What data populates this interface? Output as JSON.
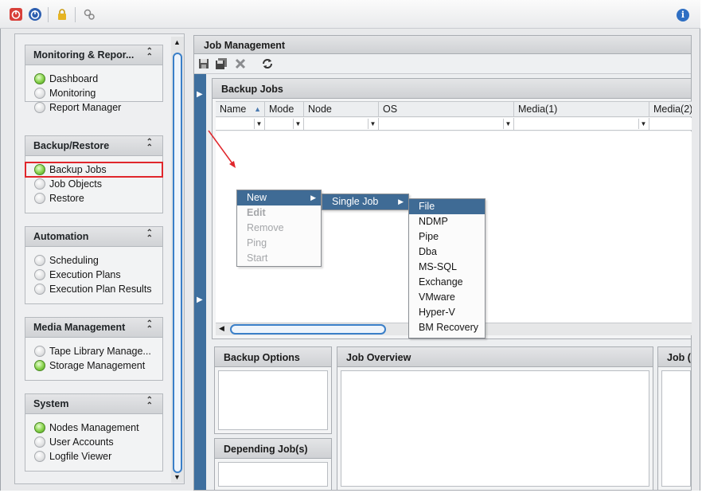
{
  "sidebar": {
    "groups": [
      {
        "title": "Monitoring & Repor...",
        "items": [
          {
            "label": "Dashboard",
            "active": true
          },
          {
            "label": "Monitoring",
            "active": false
          },
          {
            "label": "Report Manager",
            "active": false
          }
        ]
      },
      {
        "title": "Backup/Restore",
        "items": [
          {
            "label": "Backup Jobs",
            "active": true
          },
          {
            "label": "Job Objects",
            "active": false
          },
          {
            "label": "Restore",
            "active": false
          }
        ]
      },
      {
        "title": "Automation",
        "items": [
          {
            "label": "Scheduling",
            "active": false
          },
          {
            "label": "Execution Plans",
            "active": false
          },
          {
            "label": "Execution Plan Results",
            "active": false
          }
        ]
      },
      {
        "title": "Media Management",
        "items": [
          {
            "label": "Tape Library Manage...",
            "active": false
          },
          {
            "label": "Storage Management",
            "active": true
          }
        ]
      },
      {
        "title": "System",
        "items": [
          {
            "label": "Nodes Management",
            "active": true
          },
          {
            "label": "User Accounts",
            "active": false
          },
          {
            "label": "Logfile Viewer",
            "active": false
          }
        ]
      }
    ]
  },
  "main": {
    "title": "Job Management",
    "backup_jobs": {
      "title": "Backup Jobs",
      "columns": [
        "Name",
        "Mode",
        "Node",
        "OS",
        "Media(1)",
        "Media(2)"
      ]
    },
    "panels": {
      "backup_options": "Backup Options",
      "job_overview": "Job Overview",
      "job_third": "Job (",
      "depending_jobs": "Depending Job(s)"
    }
  },
  "context_menu": {
    "items": [
      {
        "label": "New",
        "enabled": true,
        "highlighted": true,
        "submenu": true
      },
      {
        "label": "Edit",
        "enabled": false
      },
      {
        "label": "Remove",
        "enabled": false
      },
      {
        "label": "Ping",
        "enabled": false
      },
      {
        "label": "Start",
        "enabled": false
      }
    ],
    "submenu": {
      "label": "Single Job"
    },
    "job_types": [
      "File",
      "NDMP",
      "Pipe",
      "Dba",
      "MS-SQL",
      "Exchange",
      "VMware",
      "Hyper-V",
      "BM Recovery"
    ]
  },
  "colors": {
    "accent": "#3f6b95",
    "selection_outline": "#e0262c",
    "arrow": "#e0262c",
    "active_dot": "#86d14a"
  }
}
